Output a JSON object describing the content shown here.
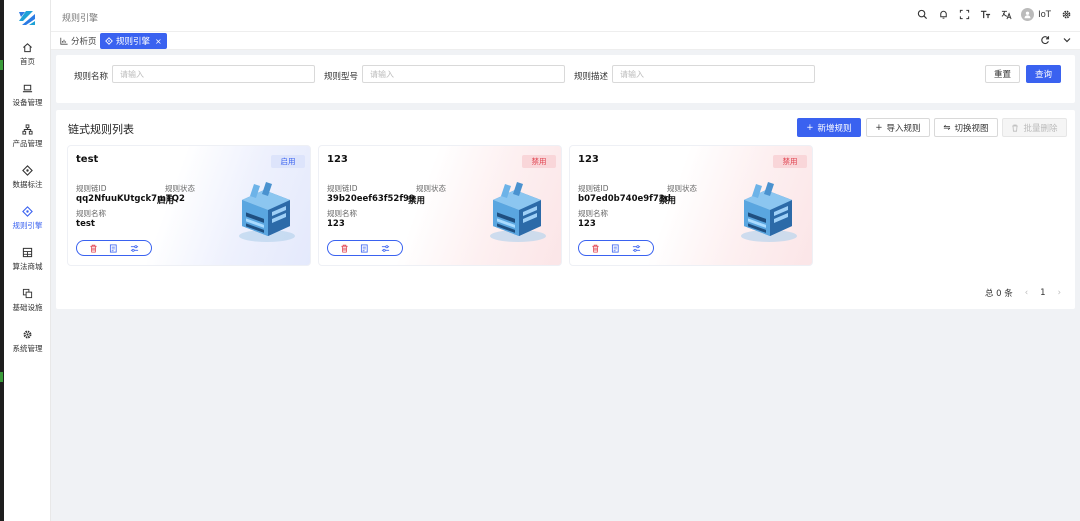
{
  "header": {
    "breadcrumb": "规则引擎",
    "user_name": "IoT"
  },
  "sidebar": {
    "items": [
      {
        "label": "首页",
        "icon": "home-icon"
      },
      {
        "label": "设备管理",
        "icon": "laptop-icon"
      },
      {
        "label": "产品管理",
        "icon": "sitemap-icon"
      },
      {
        "label": "数据标注",
        "icon": "tag-icon"
      },
      {
        "label": "规则引擎",
        "icon": "rule-engine-icon",
        "active": true
      },
      {
        "label": "算法商城",
        "icon": "grid-store-icon"
      },
      {
        "label": "基础设施",
        "icon": "copy-icon"
      },
      {
        "label": "系统管理",
        "icon": "gear-icon"
      }
    ]
  },
  "tabs": [
    {
      "label": "分析页"
    },
    {
      "label": "规则引擎",
      "active": true
    }
  ],
  "search": {
    "fields": [
      {
        "label": "规则名称",
        "placeholder": "请输入"
      },
      {
        "label": "规则型号",
        "placeholder": "请输入"
      },
      {
        "label": "规则描述",
        "placeholder": "请输入"
      }
    ],
    "reset_label": "重置",
    "query_label": "查询"
  },
  "list": {
    "title": "链式规则列表",
    "add_label": "新增规则",
    "import_label": "导入规则",
    "switch_label": "切换视图",
    "batch_delete_label": "批量删除",
    "field_labels": {
      "id": "规则链ID",
      "status": "规则状态",
      "name": "规则名称"
    },
    "cards": [
      {
        "title": "test",
        "badge": "启用",
        "id": "qq2NfuuKUtgck7mTQ2",
        "status": "启用",
        "name": "test",
        "state": "on"
      },
      {
        "title": "123",
        "badge": "禁用",
        "id": "39b20eef63f52f99",
        "status": "禁用",
        "name": "123",
        "state": "off"
      },
      {
        "title": "123",
        "badge": "禁用",
        "id": "b07ed0b740e9f73d",
        "status": "禁用",
        "name": "123",
        "state": "off"
      }
    ]
  },
  "pagination": {
    "total_text": "总 0 条",
    "current_page": "1"
  },
  "colors": {
    "primary": "#3a62f0",
    "danger": "#e0424f"
  }
}
